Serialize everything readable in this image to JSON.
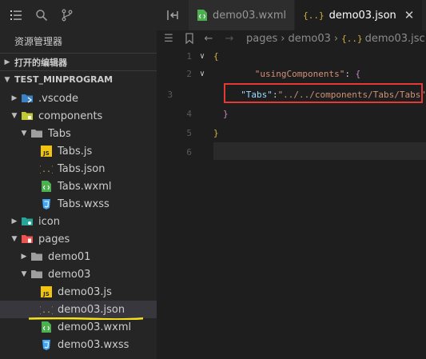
{
  "activity": {
    "icons": [
      "explorer-icon",
      "search-icon",
      "source-control-icon"
    ]
  },
  "explorer": {
    "title": "资源管理器",
    "open_editors_label": "打开的编辑器",
    "project_label": "TEST_MINPROGRAM",
    "tree": [
      {
        "label": ".vscode",
        "kind": "folder-vscode"
      },
      {
        "label": "components",
        "kind": "folder-components"
      },
      {
        "label": "Tabs",
        "kind": "folder"
      },
      {
        "label": "Tabs.js",
        "kind": "js"
      },
      {
        "label": "Tabs.json",
        "kind": "json"
      },
      {
        "label": "Tabs.wxml",
        "kind": "wxml"
      },
      {
        "label": "Tabs.wxss",
        "kind": "wxss"
      },
      {
        "label": "icon",
        "kind": "folder-icon"
      },
      {
        "label": "pages",
        "kind": "folder-pages"
      },
      {
        "label": "demo01",
        "kind": "folder"
      },
      {
        "label": "demo03",
        "kind": "folder"
      },
      {
        "label": "demo03.js",
        "kind": "js"
      },
      {
        "label": "demo03.json",
        "kind": "json"
      },
      {
        "label": "demo03.wxml",
        "kind": "wxml"
      },
      {
        "label": "demo03.wxss",
        "kind": "wxss"
      }
    ]
  },
  "tabs": [
    {
      "label": "demo03.wxml",
      "active": false
    },
    {
      "label": "demo03.json",
      "active": true
    }
  ],
  "breadcrumb": {
    "items": [
      "pages",
      "demo03",
      "demo03.jsc"
    ]
  },
  "editor": {
    "line_numbers": [
      "1",
      "2",
      "3",
      "4",
      "5",
      "6"
    ],
    "line1": "{",
    "line2_key": "\"usingComponents\"",
    "line2_colon": ": ",
    "line2_brace": "{",
    "line3_key": "\"Tabs\"",
    "line3_colon": ":",
    "line3_value": "\"../../components/Tabs/Tabs\"",
    "line4": "}",
    "line5": "}"
  },
  "colors": {
    "highlight_box": "#e53935",
    "underline": "#f5e21b",
    "json_icon": "#d4b23e",
    "js_icon": "#f1c40f",
    "wxml_icon": "#4caf50",
    "wxss_icon": "#42a5f5"
  }
}
